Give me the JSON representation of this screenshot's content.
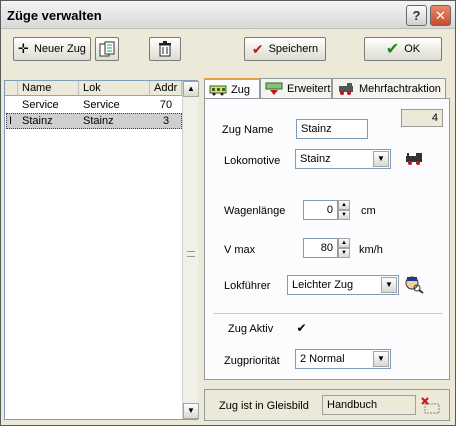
{
  "window": {
    "title": "Züge verwalten",
    "help": "?",
    "close": "✕"
  },
  "toolbar": {
    "new_train": "Neuer Zug",
    "save": "Speichern",
    "ok": "OK"
  },
  "list": {
    "columns": [
      "Name",
      "Lok",
      "Addr"
    ],
    "rows": [
      {
        "marker": "",
        "name": "Service",
        "lok": "Service",
        "addr": "70"
      },
      {
        "marker": "I",
        "name": "Stainz",
        "lok": "Stainz",
        "addr": "3"
      }
    ]
  },
  "tabs": [
    {
      "label": "Zug",
      "active": true
    },
    {
      "label": "Erweitert",
      "active": false
    },
    {
      "label": "Mehrfachtraktion",
      "active": false
    }
  ],
  "form": {
    "id_value": "4",
    "zug_name_label": "Zug Name",
    "zug_name_value": "Stainz",
    "lokomotive_label": "Lokomotive",
    "lokomotive_value": "Stainz",
    "wagenlaenge_label": "Wagenlänge",
    "wagenlaenge_value": "0",
    "wagenlaenge_unit": "cm",
    "vmax_label": "V max",
    "vmax_value": "80",
    "vmax_unit": "km/h",
    "lokfuehrer_label": "Lokführer",
    "lokfuehrer_value": "Leichter Zug",
    "zug_aktiv_label": "Zug Aktiv",
    "zug_aktiv_checked": "✔",
    "zugprioritaet_label": "Zugpriorität",
    "zugprioritaet_value": "2 Normal"
  },
  "status": {
    "label": "Zug ist in Gleisbild",
    "value": "Handbuch"
  },
  "colors": {
    "save_check": "#c01818",
    "ok_check": "#1a8a1a",
    "tab_accent": "#e8a23a"
  }
}
